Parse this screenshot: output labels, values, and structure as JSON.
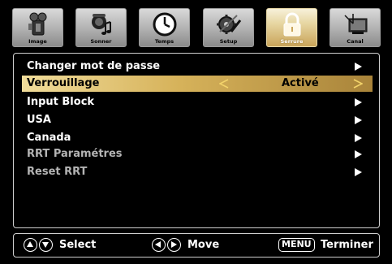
{
  "tabs": [
    {
      "label": "Image",
      "icon": "camera-icon"
    },
    {
      "label": "Sonner",
      "icon": "sound-icon"
    },
    {
      "label": "Temps",
      "icon": "clock-icon"
    },
    {
      "label": "Setup",
      "icon": "gear-icon"
    },
    {
      "label": "Serrure",
      "icon": "lock-icon",
      "active": true
    },
    {
      "label": "Canal",
      "icon": "tv-antenna-icon"
    }
  ],
  "menu": {
    "items": [
      {
        "label": "Changer mot de passe"
      },
      {
        "label": "Verrouillage",
        "value": "Activé",
        "selected": true
      },
      {
        "label": "Input Block"
      },
      {
        "label": "USA"
      },
      {
        "label": "Canada"
      },
      {
        "label": "RRT Paramétres",
        "disabled": true
      },
      {
        "label": "Reset RRT",
        "disabled": true
      }
    ]
  },
  "help": {
    "select_label": "Select",
    "move_label": "Move",
    "menu_key": "MENU",
    "exit_label": "Terminer"
  },
  "colors": {
    "accent_gold": "#d6b25a",
    "arrow_gold": "#f2d36a",
    "text": "#ffffff",
    "disabled_text": "#b4b4b4"
  }
}
